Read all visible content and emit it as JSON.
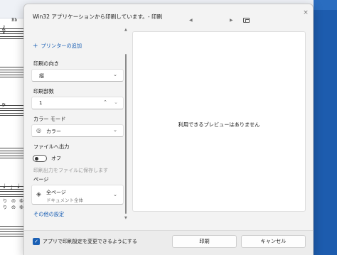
{
  "background": {
    "glyphs": [
      "Bb",
      "𝄞",
      "𝄢",
      "♩",
      "♩",
      "♩",
      "り",
      "の",
      "ゆ",
      "り",
      "の",
      "ゆ"
    ]
  },
  "dialog": {
    "title": "Win32 アプリケーションから印刷しています。- 印刷",
    "close_icon": "×"
  },
  "settings": {
    "add_printer": "プリンターの追加",
    "orientation": {
      "label": "印刷の向き",
      "value": "縦"
    },
    "copies": {
      "label": "印刷部数",
      "value": "1"
    },
    "color_mode": {
      "label": "カラー モード",
      "value": "カラー"
    },
    "print_to_file": {
      "label": "ファイルへ出力",
      "toggle_value": "オフ",
      "description": "印刷出力をファイルに保存します"
    },
    "pages": {
      "label": "ページ",
      "value": "全ページ",
      "subvalue": "ドキュメント全体"
    },
    "more_settings": "その他の設定"
  },
  "preview": {
    "message": "利用できるプレビューはありません"
  },
  "footer": {
    "checkbox_label": "アプリで印刷設定を変更できるようにする",
    "checkbox_checked": true,
    "print_button": "印刷",
    "cancel_button": "キャンセル"
  },
  "colors": {
    "accent": "#1a5fb4",
    "dialog_bg": "#f3f3f3",
    "desktop_blue": "#1d5cae"
  }
}
